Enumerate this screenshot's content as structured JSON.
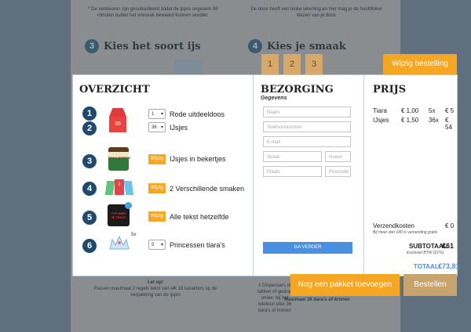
{
  "background": {
    "note_left": "* De verkleuren zijn gesubsidieerd zodat de ijsjes ongeveer 60 minuten buiten het vriesvak bewaard kunnen worden.",
    "note_right": "De doos heeft een leuke tekening en hier mag je de hoofdkleur kiezen van je doos",
    "step3_number": "3",
    "step3_title": "Kies het soort ijs",
    "step4_number": "4",
    "step4_title": "Kies je smaak",
    "flavor_tabs": [
      "1",
      "2",
      "3"
    ],
    "bottom_left_title": "Let op!",
    "bottom_left_text": "Passen maximaal 2 regels tekst van elk 18 karakters op de verpakking van de ijsjes",
    "bottom_right_text": "1 Dispensers of rakken of gedrag onder, bij het telefoon elke 36 tiara's of kronen",
    "bottom_right_max": "Maximaal 36 tiara's of kronen"
  },
  "toolbar": {
    "edit_order_label": "Wijzig bestelling"
  },
  "overview": {
    "title": "OVERZICHT",
    "items": [
      {
        "number": "1",
        "qty": "1",
        "label": "Rode uitdeeldoos"
      },
      {
        "number": "2",
        "qty": "36",
        "label": "IJsjes"
      },
      {
        "number": "3",
        "wijzig": "Wijzig",
        "label": "IJsjes in bekertjes"
      },
      {
        "number": "4",
        "wijzig": "Wijzig",
        "label": "2 Verschillende smaken"
      },
      {
        "number": "5",
        "wijzig": "Wijzig",
        "label": "Alle tekst hetzelfde"
      },
      {
        "number": "6",
        "qty": "5",
        "label": "Princessen tiara's"
      }
    ],
    "box_badge": "36",
    "cup_text": "BEN&JERRY'S",
    "tiara_multiplier": "5x",
    "cup5_text": "TYP HIER JE TEKST"
  },
  "delivery": {
    "title": "BEZORGING",
    "subtitle": "Gegevens",
    "fields": {
      "name": "Naam",
      "phone": "Telefoonnummer",
      "email": "E-mail",
      "street": "Straat",
      "house": "Huisnr.",
      "city": "Plaats",
      "postcode": "Postcode"
    },
    "submit_label": "GA VERDER"
  },
  "price": {
    "title": "PRIJS",
    "rows": [
      {
        "item": "Tiara",
        "unit": "€ 1,00",
        "qty": "5x",
        "total": "€ 5"
      },
      {
        "item": "IJsjes",
        "unit": "€ 1,50",
        "qty": "36x",
        "total": "€ 54"
      }
    ],
    "shipping_label": "Verzendkosten",
    "shipping_value": "€ 0",
    "shipping_note": "Bij meer dan €40 is verzending gratis",
    "subtotal_label": "SUBTOTAAL:",
    "subtotal_value": "€61",
    "subtotal_note": "Exclusief BTW (21%)",
    "total_label": "TOTAAL:",
    "total_value": "€73,81"
  },
  "footer": {
    "add_package_label": "Nog een pakket toevoegen",
    "order_label": "Bestellen"
  },
  "colors": {
    "accent_orange": "#f5a623",
    "navy": "#1f4a6e",
    "blue_button": "#4a90e2",
    "total_blue": "#4a90e2"
  }
}
